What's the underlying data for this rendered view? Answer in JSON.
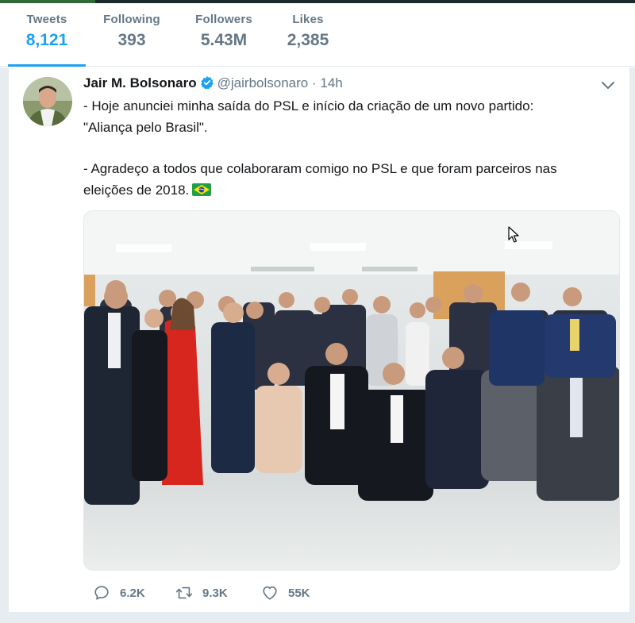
{
  "stats": [
    {
      "label": "Tweets",
      "value": "8,121",
      "active": true
    },
    {
      "label": "Following",
      "value": "393",
      "active": false
    },
    {
      "label": "Followers",
      "value": "5.43M",
      "active": false
    },
    {
      "label": "Likes",
      "value": "2,385",
      "active": false
    }
  ],
  "tweet": {
    "author_name": "Jair M. Bolsonaro",
    "handle": "@jairbolsonaro",
    "separator": "·",
    "time": "14h",
    "verified": true,
    "text_line1": "- Hoje anunciei minha saída do PSL e início da criação de um novo partido:",
    "text_line2": "\"Aliança pelo Brasil\".",
    "text_line3": "- Agradeço a todos que colaboraram comigo no PSL e que foram parceiros nas",
    "text_line4": "eleições de 2018.",
    "emoji": "brazil-flag",
    "actions": {
      "replies": "6.2K",
      "retweets": "9.3K",
      "likes": "55K"
    }
  },
  "colors": {
    "accent": "#1da1f2",
    "muted": "#657786",
    "text": "#14171a",
    "feed_bg": "#e6ecf0"
  },
  "icons": [
    "verified-badge-icon",
    "chevron-down-icon",
    "reply-icon",
    "retweet-icon",
    "like-icon",
    "brazil-flag-icon",
    "mouse-cursor-icon"
  ]
}
